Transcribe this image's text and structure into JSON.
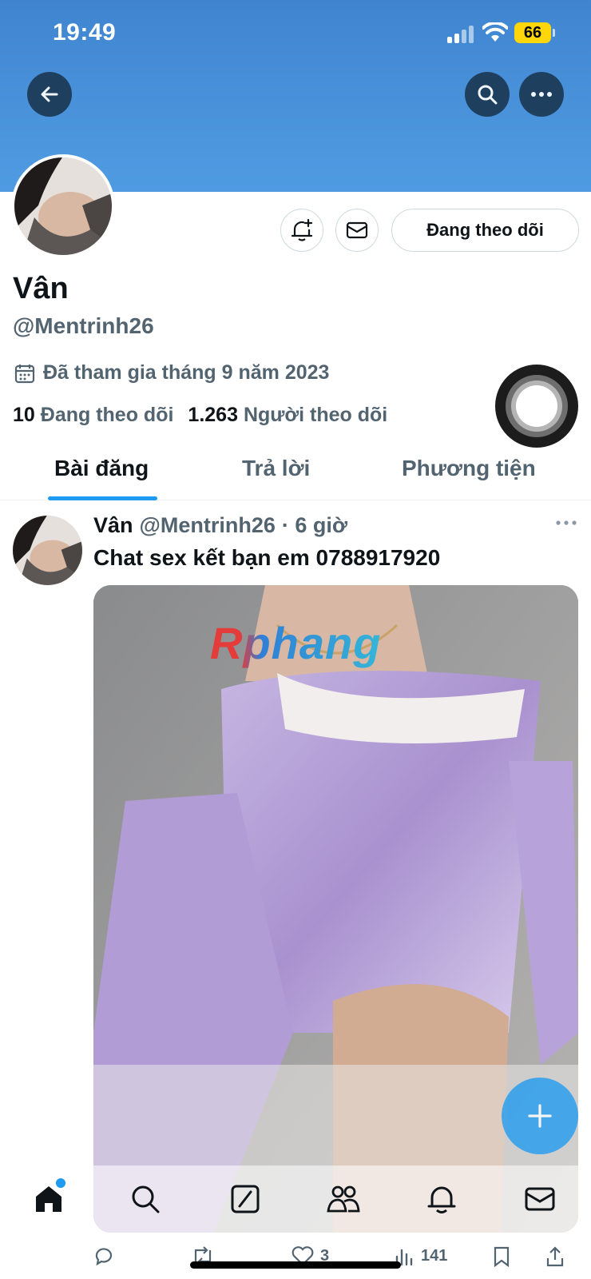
{
  "status_bar": {
    "time": "19:49",
    "battery": "66"
  },
  "profile": {
    "display_name": "Vân",
    "handle": "@Mentrinh26",
    "joined": "Đã tham gia tháng 9 năm 2023",
    "following_count": "10",
    "following_label": "Đang theo dõi",
    "followers_count": "1.263",
    "followers_label": "Người theo dõi",
    "follow_button": "Đang theo dõi"
  },
  "tabs": [
    {
      "label": "Bài đăng",
      "active": true
    },
    {
      "label": "Trả lời",
      "active": false
    },
    {
      "label": "Phương tiện",
      "active": false
    }
  ],
  "post": {
    "name": "Vân",
    "handle": "@Mentrinh26",
    "time": "· 6 giờ",
    "text": "Chat sex kết bạn em 0788917920",
    "media_watermark": "Rphang",
    "likes": "3",
    "views": "141"
  },
  "icons": {
    "back": "back-arrow-icon",
    "search": "search-icon",
    "more": "more-icon",
    "notify": "bell-plus-icon",
    "message": "mail-icon",
    "calendar": "calendar-icon"
  },
  "colors": {
    "banner": "#4a93db",
    "accent": "#1d9bf0",
    "muted_text": "#536471"
  }
}
